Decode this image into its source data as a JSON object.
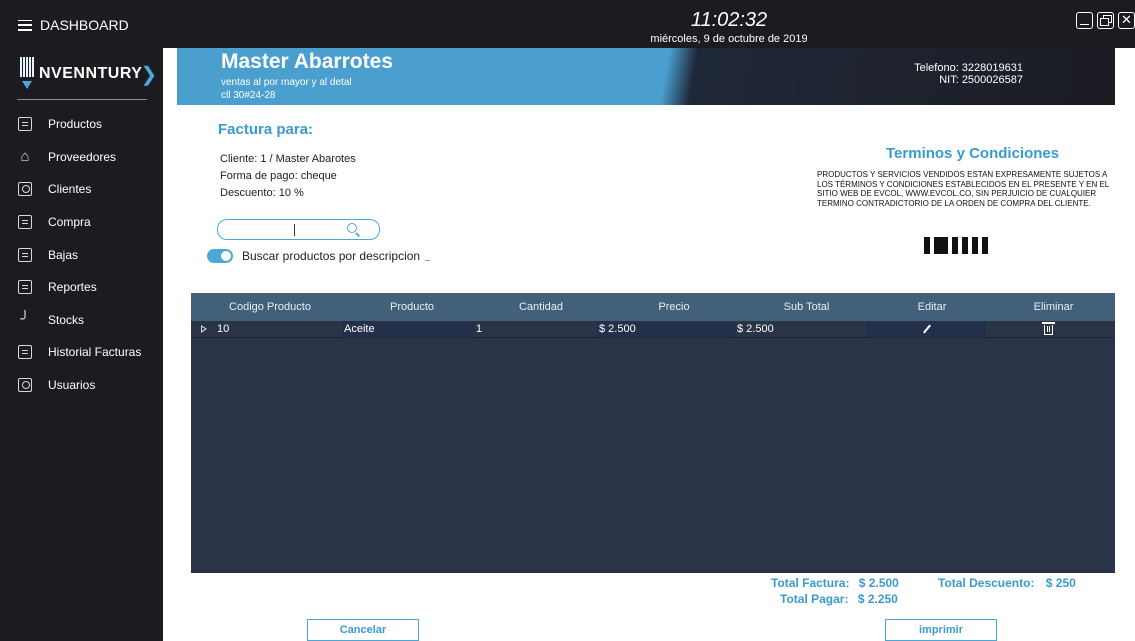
{
  "topbar": {
    "dashboard_label": "DASHBOARD",
    "time": "11:02:32",
    "date": "miércoles, 9 de octubre de 2019",
    "close_glyph": "✕"
  },
  "sidebar": {
    "logo_text": "NVENNTURY",
    "items": [
      {
        "label": "Productos",
        "icon": "box-icon"
      },
      {
        "label": "Proveedores",
        "icon": "warehouse-icon"
      },
      {
        "label": "Clientes",
        "icon": "user-icon"
      },
      {
        "label": "Compra",
        "icon": "receipt-icon"
      },
      {
        "label": "Bajas",
        "icon": "calendar-icon"
      },
      {
        "label": "Reportes",
        "icon": "report-icon"
      },
      {
        "label": "Stocks",
        "icon": "chart-icon"
      },
      {
        "label": "Historial Facturas",
        "icon": "invoice-history-icon"
      },
      {
        "label": "Usuarios",
        "icon": "users-icon"
      }
    ]
  },
  "header": {
    "shop_name": "Master Abarrotes",
    "tagline": "ventas al por mayor y al detal",
    "address": "cll 30#24-28",
    "phone": "Telefono: 3228019631",
    "nit": "NIT:  2500026587"
  },
  "invoice": {
    "title": "Factura para:",
    "client": "Cliente:  1 / Master Abarotes",
    "payment": "Forma de pago:  cheque",
    "discount": "Descuento:  10 %"
  },
  "search": {
    "toggle_label": "Buscar productos por descripcion"
  },
  "terms": {
    "title": "Terminos y Condiciones",
    "text": "PRODUCTOS Y SERVICIOS VENDIDOS ESTAN EXPRESAMENTE SUJETOS A LOS TÉRMINOS Y CONDICIONES ESTABLECIDOS EN EL PRESENTE Y EN EL SITIO WEB DE EVCOL, WWW.EVCOL.CO, SIN PERJUICIO DE CUALQUIER TERMINO CONTRADICTORIO DE LA ORDEN DE COMPRA DEL CLIENTE."
  },
  "table": {
    "columns": [
      "Codigo Producto",
      "Producto",
      "Cantidad",
      "Precio",
      "Sub Total",
      "Editar",
      "Eliminar"
    ],
    "rows": [
      {
        "codigo": "10",
        "producto": "Aceite",
        "cantidad": "1",
        "precio": "$ 2.500",
        "subtotal": "$ 2.500"
      }
    ]
  },
  "totals": {
    "factura_label": "Total Factura:",
    "factura_value": "$ 2.500",
    "descuento_label": "Total Descuento:",
    "descuento_value": "$ 250",
    "pagar_label": "Total Pagar:",
    "pagar_value": "$ 2.250"
  },
  "buttons": {
    "cancel": "Cancelar",
    "print": "imprimir"
  },
  "colors": {
    "accent": "#4aa8d8",
    "sidebar": "#1c1c20",
    "grid_bg": "#2b3347",
    "grid_header": "#42607a"
  }
}
